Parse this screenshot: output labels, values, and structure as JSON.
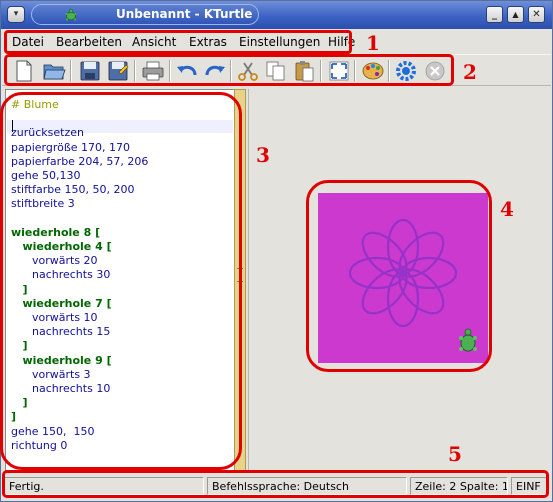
{
  "window": {
    "title": "Unbenannt - KTurtle",
    "menu_button": "▾",
    "controls": {
      "minimize": "_",
      "maximize": "▲",
      "close": "✕"
    }
  },
  "menubar": {
    "items": [
      {
        "label": "Datei",
        "mnemonic": "D"
      },
      {
        "label": "Bearbeiten",
        "mnemonic": "B"
      },
      {
        "label": "Ansicht",
        "mnemonic": "A"
      },
      {
        "label": "Extras",
        "mnemonic": "x"
      },
      {
        "label": "Einstellungen",
        "mnemonic": "E"
      },
      {
        "label": "Hilfe",
        "mnemonic": "H"
      }
    ]
  },
  "toolbar": {
    "buttons": [
      "new-file-icon",
      "open-folder-icon",
      "save-icon",
      "save-as-icon",
      "print-icon",
      "undo-icon",
      "redo-icon",
      "cut-icon",
      "copy-icon",
      "paste-icon",
      "fullscreen-icon",
      "color-picker-icon",
      "run-icon",
      "stop-icon"
    ]
  },
  "editor": {
    "lines": [
      {
        "type": "comment",
        "text": "# Blume"
      },
      {
        "type": "blank",
        "text": ""
      },
      {
        "type": "cmd",
        "text": "zurücksetzen"
      },
      {
        "type": "cmd",
        "text": "papiergröße 170, 170"
      },
      {
        "type": "cmd",
        "text": "papierfarbe 204, 57, 206"
      },
      {
        "type": "cmd",
        "text": "gehe 50,130"
      },
      {
        "type": "cmd",
        "text": "stiftfarbe 150, 50, 200"
      },
      {
        "type": "cmd",
        "text": "stiftbreite 3"
      },
      {
        "type": "blank",
        "text": ""
      },
      {
        "type": "kw",
        "text": "wiederhole 8 ["
      },
      {
        "type": "kw",
        "text": "   wiederhole 4 ["
      },
      {
        "type": "cmd",
        "text": "      vorwärts 20"
      },
      {
        "type": "cmd",
        "text": "      nachrechts 30"
      },
      {
        "type": "br",
        "text": "   ]"
      },
      {
        "type": "kw",
        "text": "   wiederhole 7 ["
      },
      {
        "type": "cmd",
        "text": "      vorwärts 10"
      },
      {
        "type": "cmd",
        "text": "      nachrechts 15"
      },
      {
        "type": "br",
        "text": "   ]"
      },
      {
        "type": "kw",
        "text": "   wiederhole 9 ["
      },
      {
        "type": "cmd",
        "text": "      vorwärts 3"
      },
      {
        "type": "cmd",
        "text": "      nachrechts 10"
      },
      {
        "type": "br",
        "text": "   ]"
      },
      {
        "type": "br",
        "text": "]"
      },
      {
        "type": "cmd",
        "text": "gehe 150,  150"
      },
      {
        "type": "cmd",
        "text": "richtung 0"
      }
    ]
  },
  "canvas": {
    "paper_color": "#cc39ce",
    "pen_color": "#9632c8",
    "petal_count": 8
  },
  "statusbar": {
    "status": "Fertig.",
    "language": "Befehlssprache: Deutsch",
    "position": "Zeile: 2 Spalte: 1",
    "mode": "EINF"
  },
  "annotations": [
    "1",
    "2",
    "3",
    "4",
    "5"
  ],
  "colors": {
    "annotation": "#e00000",
    "titlebar": "#3c63c4"
  }
}
